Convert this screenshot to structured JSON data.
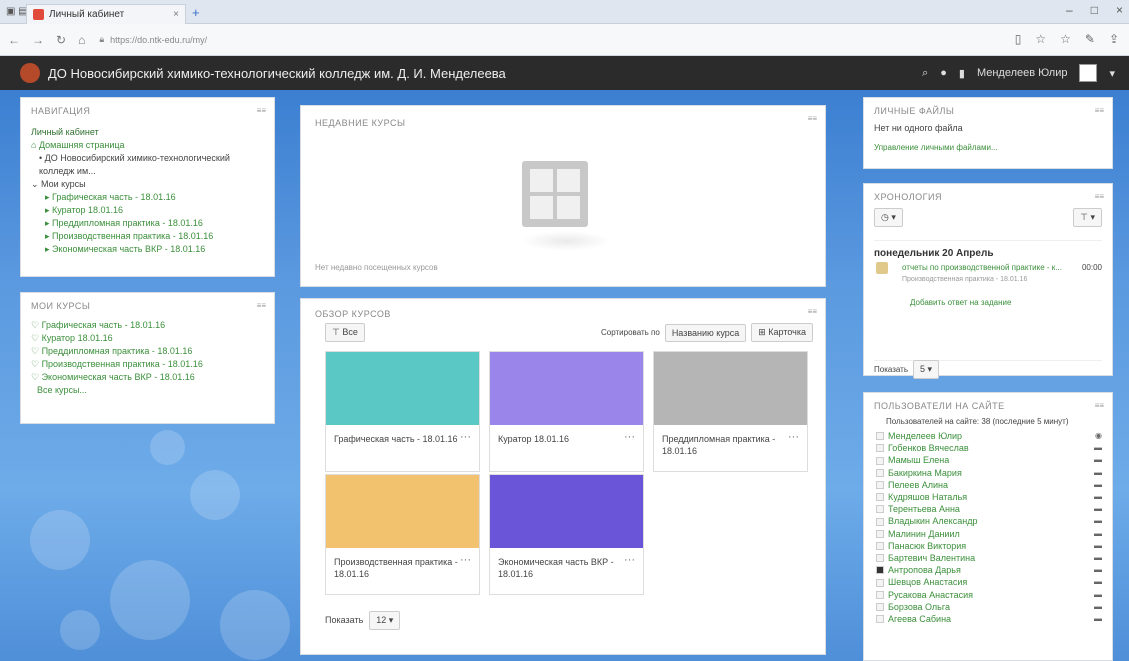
{
  "browser": {
    "tab_title": "Личный кабинет",
    "url": "https://do.ntk-edu.ru/my/"
  },
  "site": {
    "title": "ДО Новосибирский химико-технологический колледж им. Д. И. Менделеева",
    "user": "Менделеев Юлир"
  },
  "navigation": {
    "title": "НАВИГАЦИЯ",
    "items": [
      "Личный кабинет",
      "Домашняя страница",
      "ДО Новосибирский химико-технологический колледж им...",
      "Мои курсы",
      "Графическая часть - 18.01.16",
      "Куратор 18.01.16",
      "Преддипломная практика - 18.01.16",
      "Производственная практика - 18.01.16",
      "Экономическая часть ВКР - 18.01.16"
    ]
  },
  "mycourses": {
    "title": "МОИ КУРСЫ",
    "items": [
      "Графическая часть - 18.01.16",
      "Куратор 18.01.16",
      "Преддипломная практика - 18.01.16",
      "Производственная практика - 18.01.16",
      "Экономическая часть ВКР - 18.01.16"
    ],
    "all": "Все курсы..."
  },
  "recent": {
    "title": "НЕДАВНИЕ КУРСЫ",
    "empty": "Нет недавно посещенных курсов"
  },
  "overview": {
    "title": "ОБЗОР КУРСОВ",
    "filter": "Все",
    "sort_label": "Сортировать по",
    "sort_value": "Названию курса",
    "view": "Карточка",
    "show_label": "Показать",
    "show_value": "12",
    "courses": [
      {
        "name": "Графическая часть - 18.01.16",
        "color": "#5ac9c6"
      },
      {
        "name": "Куратор 18.01.16",
        "color": "#9a86ea"
      },
      {
        "name": "Преддипломная практика - 18.01.16",
        "color": "#b5b5b5"
      },
      {
        "name": "Производственная практика - 18.01.16",
        "color": "#f2c26e"
      },
      {
        "name": "Экономическая часть ВКР - 18.01.16",
        "color": "#6a55d8"
      }
    ]
  },
  "files": {
    "title": "ЛИЧНЫЕ ФАЙЛЫ",
    "empty": "Нет ни одного файла",
    "manage": "Управление личными файлами..."
  },
  "timeline": {
    "title": "ХРОНОЛОГИЯ",
    "date": "понедельник 20 Апрель",
    "event": "отчеты по производственной практике - к...",
    "time": "00:00",
    "course": "Производственная практика - 18.01.16",
    "add": "Добавить ответ на задание",
    "show_label": "Показать",
    "show_value": "5"
  },
  "online": {
    "title": "ПОЛЬЗОВАТЕЛИ НА САЙТЕ",
    "summary": "Пользователей на сайте: 38 (последние 5 минут)",
    "users": [
      "Менделеев Юлир",
      "Гобенков Вячеслав",
      "Мамыш Елена",
      "Бакиркина Мария",
      "Пелеев Алина",
      "Кудряшов Наталья",
      "Терентьева Анна",
      "Владыкин Александр",
      "Малинин Даниил",
      "Панасюк Виктория",
      "Бартевич Валентина",
      "Антропова Дарья",
      "Шевцов Анастасия",
      "Русакова Анастасия",
      "Борзова Ольга",
      "Агеева Сабина"
    ]
  }
}
